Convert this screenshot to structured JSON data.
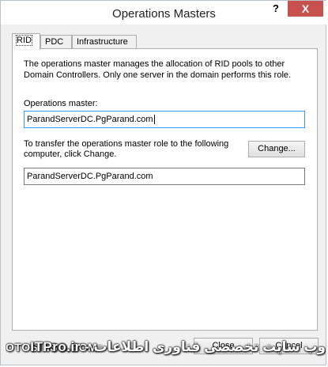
{
  "window": {
    "title": "Operations Masters",
    "help_label": "?",
    "close_label": "X"
  },
  "tabs": [
    {
      "label": "RID",
      "active": true
    },
    {
      "label": "PDC",
      "active": false
    },
    {
      "label": "Infrastructure",
      "active": false
    }
  ],
  "rid": {
    "description": "The operations master manages the allocation of RID pools to other Domain Controllers. Only one server in the domain performs this role.",
    "operations_master_label": "Operations master:",
    "operations_master_value": "ParandServerDC.PgParand.com",
    "transfer_text": "To transfer the operations master role to the following computer, click Change.",
    "change_button": "Change...",
    "target_value": "ParandServerDC.PgParand.com"
  },
  "footer": {
    "close_button": "Close",
    "cancel_button": "Cancel"
  },
  "watermark": {
    "left": "OTOSINSO.COM",
    "right": "ITPro.ir - وب سایت تخصصی فناوری اطلاعات"
  }
}
